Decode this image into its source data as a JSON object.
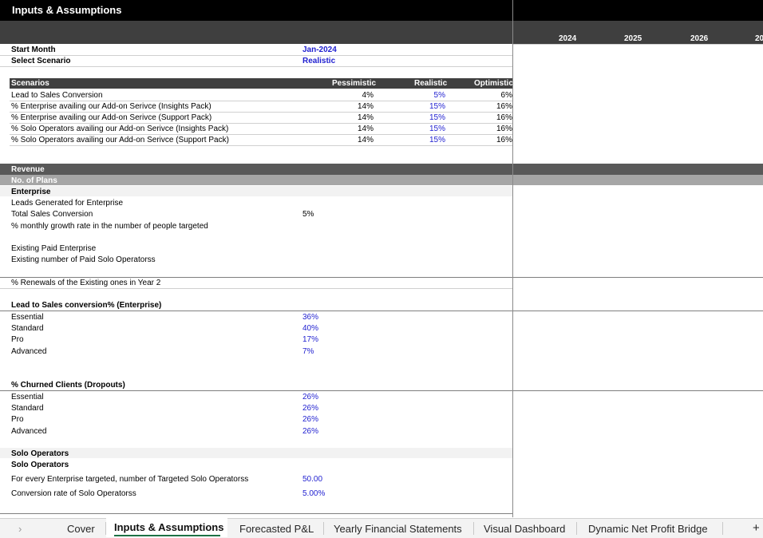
{
  "sheet": {
    "title": "Inputs & Assumptions",
    "years": [
      "2024",
      "2025",
      "2026",
      "20"
    ],
    "start_month": {
      "label": "Start Month",
      "value": "Jan-2024"
    },
    "select_scenario": {
      "label": "Select Scenario",
      "value": "Realistic"
    },
    "scenarios": {
      "header": [
        "Scenarios",
        "Pessimistic",
        "Realistic",
        "Optimistic"
      ],
      "rows": [
        {
          "label": "Lead to Sales Conversion",
          "values": [
            "4%",
            "5%",
            "6%"
          ]
        },
        {
          "label": "% Enterprise availing our Add-on Serivce (Insights Pack)",
          "values": [
            "14%",
            "15%",
            "16%"
          ]
        },
        {
          "label": "% Enterprise availing our Add-on Serivce (Support Pack)",
          "values": [
            "14%",
            "15%",
            "16%"
          ]
        },
        {
          "label": "% Solo Operators availing our Add-on Serivce (Insights Pack)",
          "values": [
            "14%",
            "15%",
            "16%"
          ]
        },
        {
          "label": "% Solo Operators availing our Add-on Serivce (Support Pack)",
          "values": [
            "14%",
            "15%",
            "16%"
          ]
        }
      ]
    },
    "revenue": "Revenue",
    "no_of_plans": "No. of Plans",
    "enterprise": {
      "heading": "Enterprise",
      "leads": "Leads Generated for Enterprise",
      "total_sales_conversion": {
        "label": "Total Sales Conversion",
        "value": "5%"
      },
      "monthly_growth": "% monthly growth rate in the number of people targeted",
      "existing_paid_enterprise": "Existing Paid Enterprise",
      "existing_paid_solo": "Existing number of Paid Solo Operatorss",
      "renewals": "% Renewals of the Existing ones in Year 2"
    },
    "lead_to_sales": {
      "heading": "Lead to Sales conversion%  (Enterprise)",
      "rows": [
        {
          "label": "Essential",
          "value": "36%"
        },
        {
          "label": "Standard",
          "value": "40%"
        },
        {
          "label": "Pro",
          "value": "17%"
        },
        {
          "label": "Advanced",
          "value": "7%"
        }
      ]
    },
    "churn": {
      "heading": "% Churned Clients (Dropouts)",
      "rows": [
        {
          "label": "Essential",
          "value": "26%"
        },
        {
          "label": "Standard",
          "value": "26%"
        },
        {
          "label": "Pro",
          "value": "26%"
        },
        {
          "label": "Advanced",
          "value": "26%"
        }
      ]
    },
    "solo": {
      "heading": "Solo Operators",
      "subheading": "Solo Operators",
      "targeted": {
        "label": "For every Enterprise targeted, number of Targeted Solo Operatorss",
        "value": "50.00"
      },
      "conversion": {
        "label": "Conversion rate of Solo Operatorss",
        "value": "5.00%"
      }
    }
  },
  "tabs": {
    "items": [
      "Cover",
      "Inputs & Assumptions",
      "Forecasted P&L",
      "Yearly Financial Statements",
      "Visual Dashboard",
      "Dynamic Net Profit Bridge"
    ],
    "active": "Inputs & Assumptions",
    "nav_left": "›",
    "add": "+"
  }
}
